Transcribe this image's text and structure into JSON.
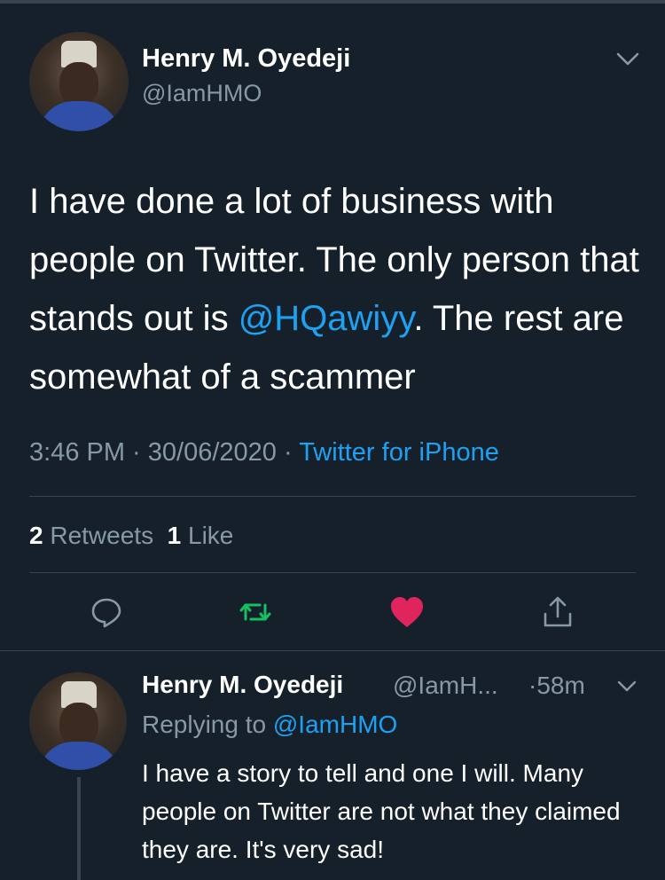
{
  "main_tweet": {
    "author_name": "Henry M. Oyedeji",
    "author_handle": "@IamHMO",
    "text_parts": {
      "before": "I have done a lot of business with people on Twitter. The only person that stands out is ",
      "mention": "@HQawiyy",
      "after": ". The rest are somewhat of a scammer"
    },
    "time": "3:46 PM",
    "date": "30/06/2020",
    "source": "Twitter for iPhone",
    "retweets_count": "2",
    "retweets_label": "Retweets",
    "likes_count": "1",
    "likes_label": "Like"
  },
  "reply": {
    "author_name": "Henry M. Oyedeji",
    "author_handle": "@IamH...",
    "time": "58m",
    "replying_to_label": "Replying to",
    "replying_to_handle": "@IamHMO",
    "text": "I have a story to tell and one I will. Many people on Twitter are not what they claimed they are. It's very sad!"
  },
  "icons": {
    "reply": "reply-icon",
    "retweet": "retweet-icon",
    "like": "heart-icon",
    "share": "share-icon",
    "menu": "chevron-down-icon"
  },
  "colors": {
    "background": "#15202b",
    "text": "#ffffff",
    "muted": "#8899a6",
    "link": "#1da1f2",
    "retweet": "#17bf63",
    "like": "#e0245e",
    "divider": "#38444d"
  }
}
